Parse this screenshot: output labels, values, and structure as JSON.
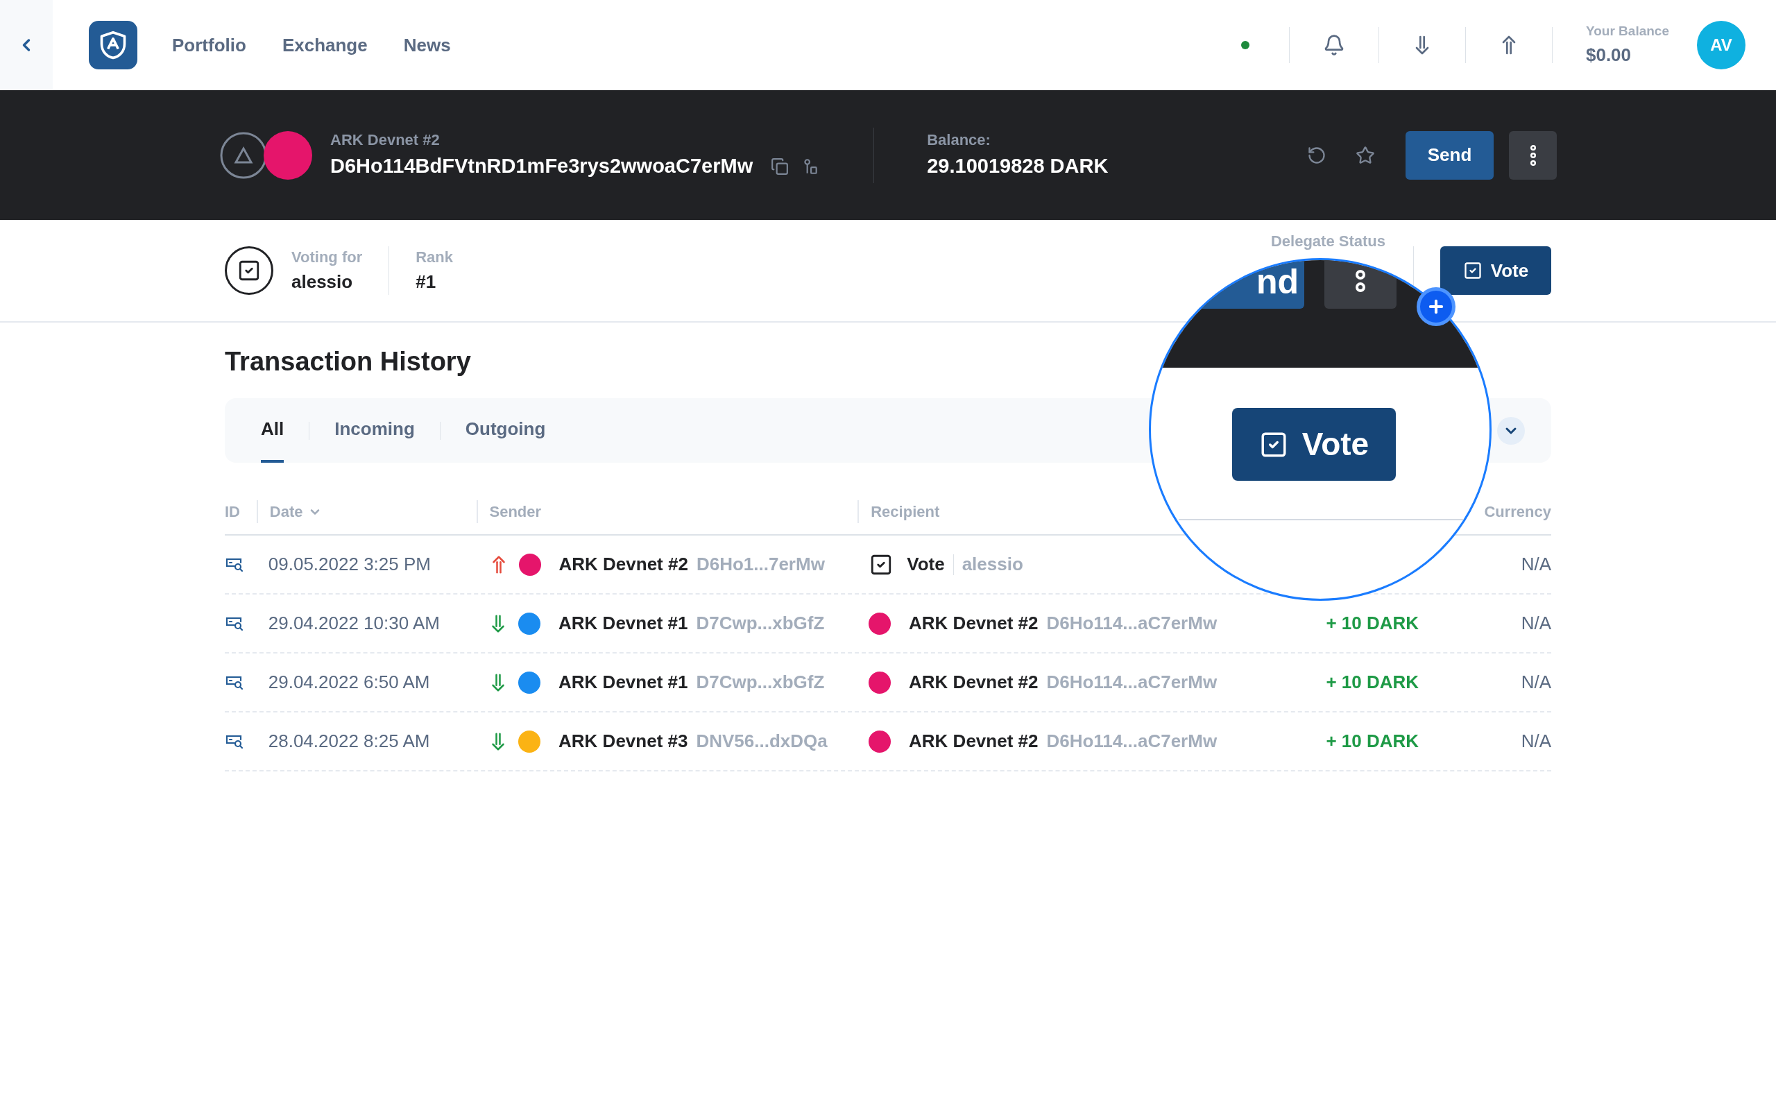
{
  "nav": {
    "items": [
      {
        "label": "Portfolio"
      },
      {
        "label": "Exchange"
      },
      {
        "label": "News"
      }
    ]
  },
  "account": {
    "balance_label": "Your Balance",
    "balance": "$0.00",
    "initials": "AV"
  },
  "wallet": {
    "network": "ARK Devnet #2",
    "address": "D6Ho114BdFVtnRD1mFe3rys2wwoaC7erMw",
    "balance_label": "Balance:",
    "balance": "29.10019828 DARK",
    "send_label": "Send"
  },
  "voting": {
    "label": "Voting for",
    "delegate": "alessio",
    "rank_label": "Rank",
    "rank": "#1",
    "status_label": "Delegate Status",
    "vote_label": "Vote"
  },
  "history": {
    "title": "Transaction History",
    "tabs": [
      {
        "label": "All",
        "selected": true
      },
      {
        "label": "Incoming",
        "selected": false
      },
      {
        "label": "Outgoing",
        "selected": false
      }
    ],
    "columns": [
      "ID",
      "Date",
      "Sender",
      "Recipient",
      "Currency"
    ],
    "rows": [
      {
        "date": "09.05.2022 3:25 PM",
        "kind": "out",
        "sender": {
          "name": "ARK Devnet #2",
          "address": "D6Ho1...7erMw",
          "color": "#e5156b"
        },
        "recipient": {
          "kind": "vote",
          "label": "Vote",
          "name": "alessio"
        },
        "currency": "N/A"
      },
      {
        "date": "29.04.2022 10:30 AM",
        "kind": "in",
        "sender": {
          "name": "ARK Devnet #1",
          "address": "D7Cwp...xbGfZ",
          "color": "#1a8cf0"
        },
        "recipient": {
          "kind": "wallet",
          "name": "ARK Devnet #2",
          "address": "D6Ho114...aC7erMw",
          "color": "#e5156b"
        },
        "amount": "+ 10 DARK",
        "currency": "N/A"
      },
      {
        "date": "29.04.2022 6:50 AM",
        "kind": "in",
        "sender": {
          "name": "ARK Devnet #1",
          "address": "D7Cwp...xbGfZ",
          "color": "#1a8cf0"
        },
        "recipient": {
          "kind": "wallet",
          "name": "ARK Devnet #2",
          "address": "D6Ho114...aC7erMw",
          "color": "#e5156b"
        },
        "amount": "+ 10 DARK",
        "currency": "N/A"
      },
      {
        "date": "28.04.2022 8:25 AM",
        "kind": "in",
        "sender": {
          "name": "ARK Devnet #3",
          "address": "DNV56...dxDQa",
          "color": "#fbb314"
        },
        "recipient": {
          "kind": "wallet",
          "name": "ARK Devnet #2",
          "address": "D6Ho114...aC7erMw",
          "color": "#e5156b"
        },
        "amount": "+ 10 DARK",
        "currency": "N/A"
      }
    ]
  },
  "magnifier": {
    "send_fragment": "nd",
    "vote_label": "Vote"
  }
}
